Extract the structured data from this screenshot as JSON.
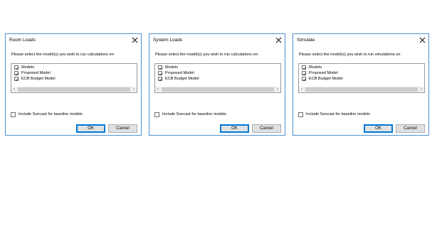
{
  "dialogs": [
    {
      "title": "Room Loads",
      "prompt": "Please select the model(s) you wish to run calculations on:",
      "models": [
        {
          "label": "Models",
          "checked": true
        },
        {
          "label": "Proposed Model",
          "checked": true
        },
        {
          "label": "ECB Budget Model",
          "checked": true
        }
      ],
      "suncast_label": "Include Suncast for baseline models",
      "suncast_checked": false,
      "ok_label": "OK",
      "cancel_label": "Cancel"
    },
    {
      "title": "System Loads",
      "prompt": "Please select the model(s) you wish to run calculations on:",
      "models": [
        {
          "label": "Models",
          "checked": true
        },
        {
          "label": "Proposed Model",
          "checked": true
        },
        {
          "label": "ECB Budget Model",
          "checked": true
        }
      ],
      "suncast_label": "Include Suncast for baseline models",
      "suncast_checked": false,
      "ok_label": "OK",
      "cancel_label": "Cancel"
    },
    {
      "title": "Simulate",
      "prompt": "Please select the model(s) you wish to run simulations on:",
      "models": [
        {
          "label": "Models",
          "checked": true
        },
        {
          "label": "Proposed Model",
          "checked": true
        },
        {
          "label": "ECB Budget Model",
          "checked": true
        }
      ],
      "suncast_label": "Include Suncast for baseline models",
      "suncast_checked": false,
      "ok_label": "OK",
      "cancel_label": "Cancel"
    }
  ],
  "scroll_left_glyph": "‹",
  "scroll_right_glyph": "›",
  "colors": {
    "window_border": "#4f8fcf",
    "default_button_border": "#0078d7",
    "button_face": "#e1e1e1"
  }
}
